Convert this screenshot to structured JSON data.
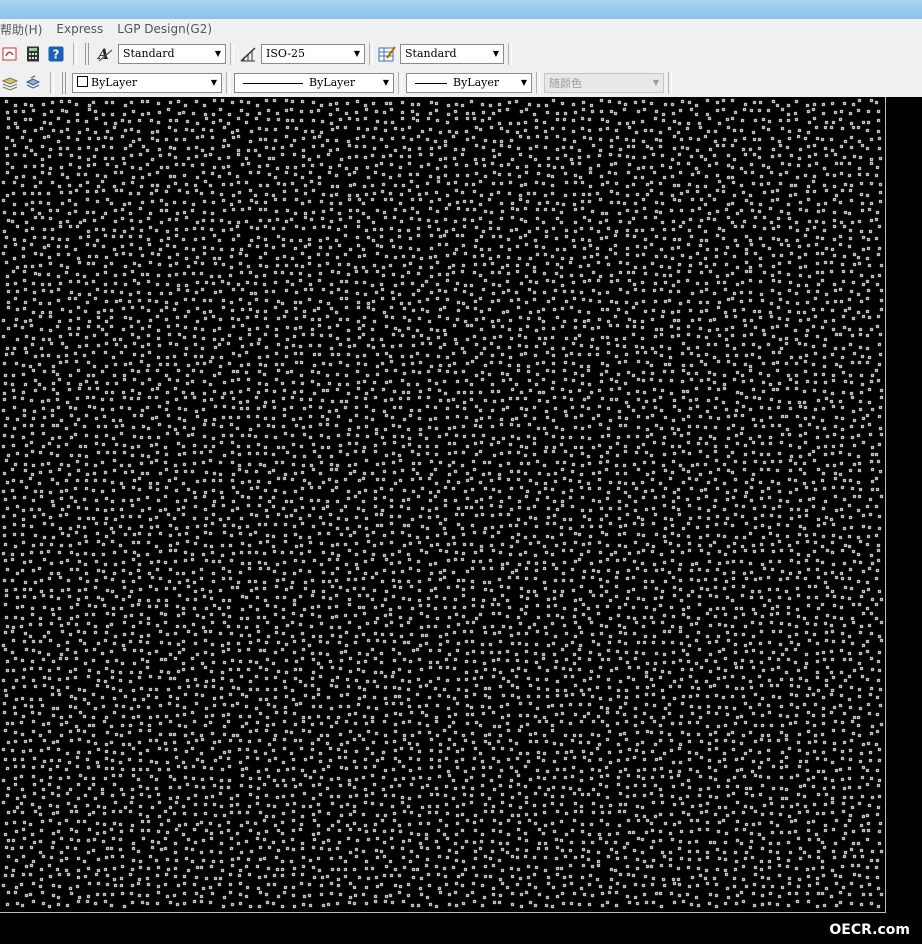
{
  "menu": [
    "帮助(H)",
    "Express",
    "LGP Design(G2)"
  ],
  "toolbar1": {
    "text_style": "Standard",
    "dim_style": "ISO-25",
    "table_style": "Standard"
  },
  "toolbar2": {
    "layer": "ByLayer",
    "linetype": "ByLayer",
    "lineweight": "ByLayer",
    "color": "随颜色"
  },
  "watermark": "OECR.com",
  "colors": {
    "canvas": "#000000",
    "dot": "#ffffff",
    "toolbar": "#f0f0f0"
  }
}
